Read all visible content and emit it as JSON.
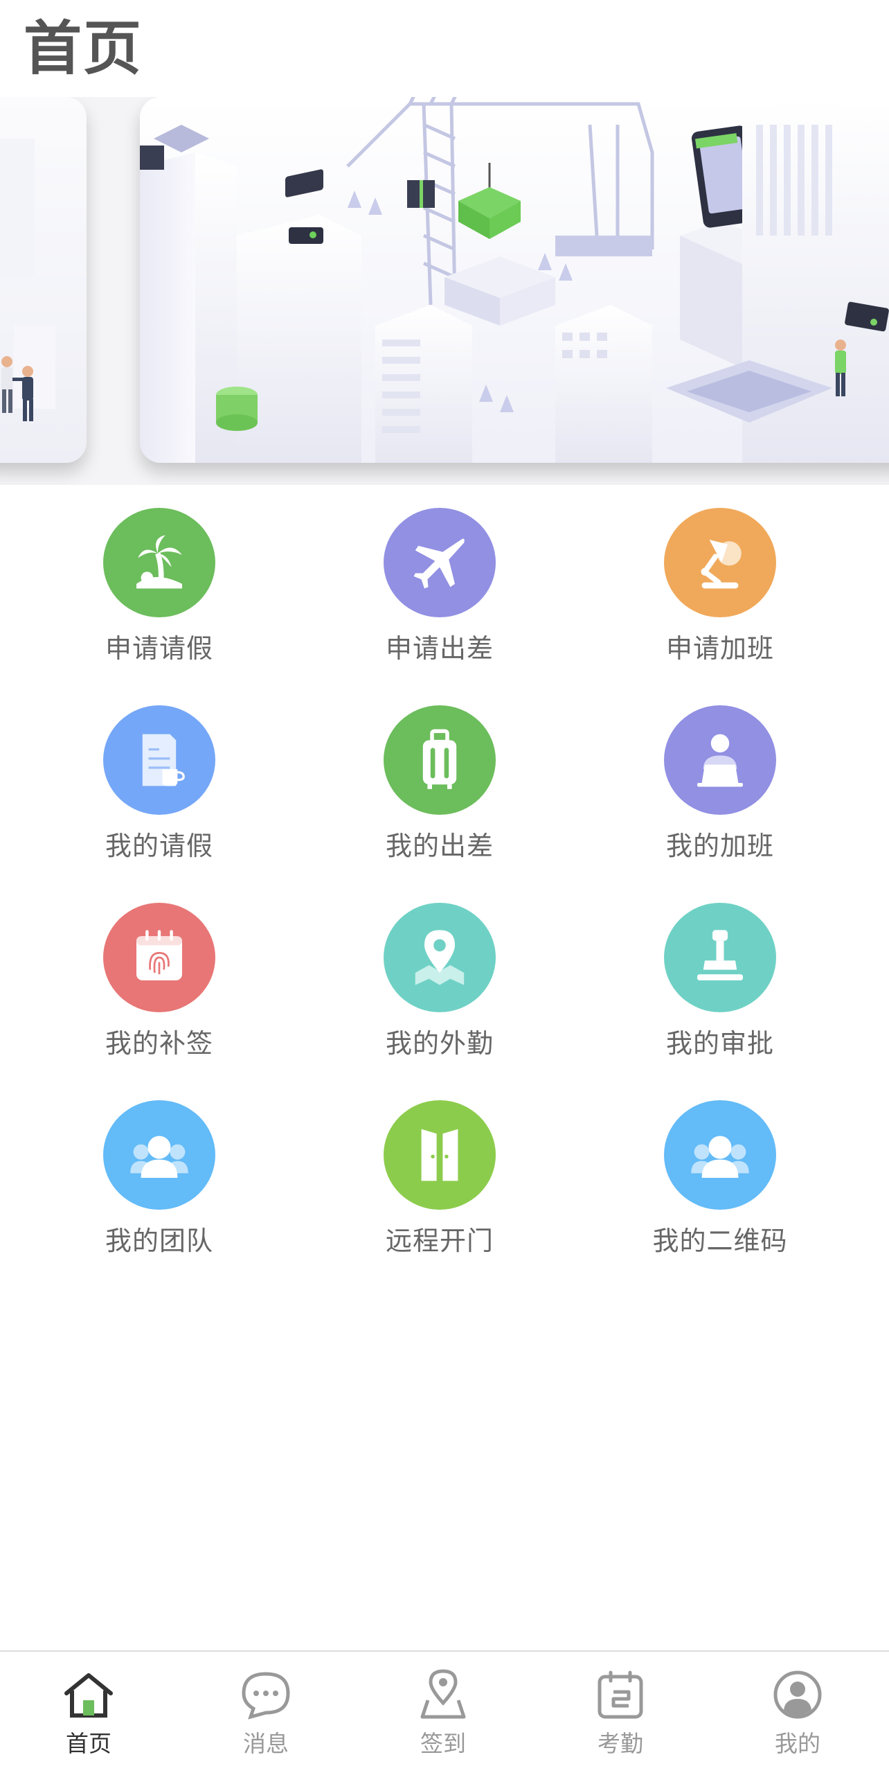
{
  "header": {
    "title": "首页"
  },
  "colors": {
    "green": "#6cbd5c",
    "purple": "#9190e3",
    "orange": "#f0a95a",
    "blue": "#75a7f8",
    "red": "#e87676",
    "teal": "#6fd1c5",
    "lime": "#8ccc4c",
    "sky": "#63bbf8",
    "tab_active": "#333333",
    "tab_inactive": "#999999"
  },
  "grid": {
    "items": [
      {
        "label": "申请请假",
        "icon": "palm-tree-icon",
        "color": "#6cbd5c"
      },
      {
        "label": "申请出差",
        "icon": "airplane-icon",
        "color": "#9190e3"
      },
      {
        "label": "申请加班",
        "icon": "desk-lamp-icon",
        "color": "#f0a95a"
      },
      {
        "label": "我的请假",
        "icon": "document-icon",
        "color": "#75a7f8"
      },
      {
        "label": "我的出差",
        "icon": "suitcase-icon",
        "color": "#6cbd5c"
      },
      {
        "label": "我的加班",
        "icon": "person-laptop-icon",
        "color": "#9190e3"
      },
      {
        "label": "我的补签",
        "icon": "fingerprint-calendar-icon",
        "color": "#e87676"
      },
      {
        "label": "我的外勤",
        "icon": "map-pin-icon",
        "color": "#6fd1c5"
      },
      {
        "label": "我的审批",
        "icon": "stamp-icon",
        "color": "#6fd1c5"
      },
      {
        "label": "我的团队",
        "icon": "team-icon",
        "color": "#63bbf8"
      },
      {
        "label": "远程开门",
        "icon": "door-icon",
        "color": "#8ccc4c"
      },
      {
        "label": "我的二维码",
        "icon": "team-icon",
        "color": "#63bbf8"
      }
    ]
  },
  "tabbar": {
    "items": [
      {
        "label": "首页",
        "icon": "home-icon",
        "active": true
      },
      {
        "label": "消息",
        "icon": "message-icon",
        "active": false
      },
      {
        "label": "签到",
        "icon": "location-checkin-icon",
        "active": false
      },
      {
        "label": "考勤",
        "icon": "attendance-icon",
        "active": false
      },
      {
        "label": "我的",
        "icon": "profile-icon",
        "active": false
      }
    ]
  }
}
